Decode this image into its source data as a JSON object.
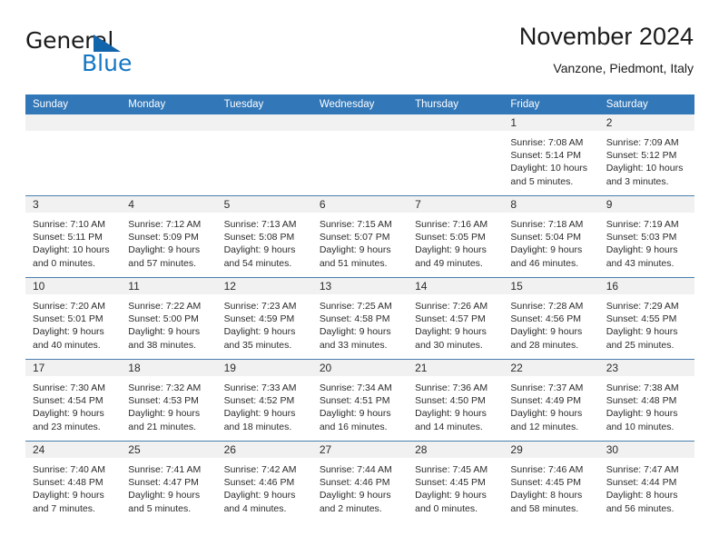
{
  "brand": {
    "name_part1": "General",
    "name_part2": "Blue",
    "triangle_color": "#1265ab",
    "blue_color": "#1477c4"
  },
  "header": {
    "title": "November 2024",
    "subtitle": "Vanzone, Piedmont, Italy"
  },
  "theme": {
    "header_blue": "#3277b8",
    "row_divider": "#4a7fae",
    "day_band": "#f1f1f1",
    "text": "#2b2b2b"
  },
  "calendar": {
    "weekday_headers": [
      "Sunday",
      "Monday",
      "Tuesday",
      "Wednesday",
      "Thursday",
      "Friday",
      "Saturday"
    ],
    "weeks": [
      [
        {
          "day": "",
          "sunrise": "",
          "sunset": "",
          "daylight": ""
        },
        {
          "day": "",
          "sunrise": "",
          "sunset": "",
          "daylight": ""
        },
        {
          "day": "",
          "sunrise": "",
          "sunset": "",
          "daylight": ""
        },
        {
          "day": "",
          "sunrise": "",
          "sunset": "",
          "daylight": ""
        },
        {
          "day": "",
          "sunrise": "",
          "sunset": "",
          "daylight": ""
        },
        {
          "day": "1",
          "sunrise": "Sunrise: 7:08 AM",
          "sunset": "Sunset: 5:14 PM",
          "daylight": "Daylight: 10 hours and 5 minutes."
        },
        {
          "day": "2",
          "sunrise": "Sunrise: 7:09 AM",
          "sunset": "Sunset: 5:12 PM",
          "daylight": "Daylight: 10 hours and 3 minutes."
        }
      ],
      [
        {
          "day": "3",
          "sunrise": "Sunrise: 7:10 AM",
          "sunset": "Sunset: 5:11 PM",
          "daylight": "Daylight: 10 hours and 0 minutes."
        },
        {
          "day": "4",
          "sunrise": "Sunrise: 7:12 AM",
          "sunset": "Sunset: 5:09 PM",
          "daylight": "Daylight: 9 hours and 57 minutes."
        },
        {
          "day": "5",
          "sunrise": "Sunrise: 7:13 AM",
          "sunset": "Sunset: 5:08 PM",
          "daylight": "Daylight: 9 hours and 54 minutes."
        },
        {
          "day": "6",
          "sunrise": "Sunrise: 7:15 AM",
          "sunset": "Sunset: 5:07 PM",
          "daylight": "Daylight: 9 hours and 51 minutes."
        },
        {
          "day": "7",
          "sunrise": "Sunrise: 7:16 AM",
          "sunset": "Sunset: 5:05 PM",
          "daylight": "Daylight: 9 hours and 49 minutes."
        },
        {
          "day": "8",
          "sunrise": "Sunrise: 7:18 AM",
          "sunset": "Sunset: 5:04 PM",
          "daylight": "Daylight: 9 hours and 46 minutes."
        },
        {
          "day": "9",
          "sunrise": "Sunrise: 7:19 AM",
          "sunset": "Sunset: 5:03 PM",
          "daylight": "Daylight: 9 hours and 43 minutes."
        }
      ],
      [
        {
          "day": "10",
          "sunrise": "Sunrise: 7:20 AM",
          "sunset": "Sunset: 5:01 PM",
          "daylight": "Daylight: 9 hours and 40 minutes."
        },
        {
          "day": "11",
          "sunrise": "Sunrise: 7:22 AM",
          "sunset": "Sunset: 5:00 PM",
          "daylight": "Daylight: 9 hours and 38 minutes."
        },
        {
          "day": "12",
          "sunrise": "Sunrise: 7:23 AM",
          "sunset": "Sunset: 4:59 PM",
          "daylight": "Daylight: 9 hours and 35 minutes."
        },
        {
          "day": "13",
          "sunrise": "Sunrise: 7:25 AM",
          "sunset": "Sunset: 4:58 PM",
          "daylight": "Daylight: 9 hours and 33 minutes."
        },
        {
          "day": "14",
          "sunrise": "Sunrise: 7:26 AM",
          "sunset": "Sunset: 4:57 PM",
          "daylight": "Daylight: 9 hours and 30 minutes."
        },
        {
          "day": "15",
          "sunrise": "Sunrise: 7:28 AM",
          "sunset": "Sunset: 4:56 PM",
          "daylight": "Daylight: 9 hours and 28 minutes."
        },
        {
          "day": "16",
          "sunrise": "Sunrise: 7:29 AM",
          "sunset": "Sunset: 4:55 PM",
          "daylight": "Daylight: 9 hours and 25 minutes."
        }
      ],
      [
        {
          "day": "17",
          "sunrise": "Sunrise: 7:30 AM",
          "sunset": "Sunset: 4:54 PM",
          "daylight": "Daylight: 9 hours and 23 minutes."
        },
        {
          "day": "18",
          "sunrise": "Sunrise: 7:32 AM",
          "sunset": "Sunset: 4:53 PM",
          "daylight": "Daylight: 9 hours and 21 minutes."
        },
        {
          "day": "19",
          "sunrise": "Sunrise: 7:33 AM",
          "sunset": "Sunset: 4:52 PM",
          "daylight": "Daylight: 9 hours and 18 minutes."
        },
        {
          "day": "20",
          "sunrise": "Sunrise: 7:34 AM",
          "sunset": "Sunset: 4:51 PM",
          "daylight": "Daylight: 9 hours and 16 minutes."
        },
        {
          "day": "21",
          "sunrise": "Sunrise: 7:36 AM",
          "sunset": "Sunset: 4:50 PM",
          "daylight": "Daylight: 9 hours and 14 minutes."
        },
        {
          "day": "22",
          "sunrise": "Sunrise: 7:37 AM",
          "sunset": "Sunset: 4:49 PM",
          "daylight": "Daylight: 9 hours and 12 minutes."
        },
        {
          "day": "23",
          "sunrise": "Sunrise: 7:38 AM",
          "sunset": "Sunset: 4:48 PM",
          "daylight": "Daylight: 9 hours and 10 minutes."
        }
      ],
      [
        {
          "day": "24",
          "sunrise": "Sunrise: 7:40 AM",
          "sunset": "Sunset: 4:48 PM",
          "daylight": "Daylight: 9 hours and 7 minutes."
        },
        {
          "day": "25",
          "sunrise": "Sunrise: 7:41 AM",
          "sunset": "Sunset: 4:47 PM",
          "daylight": "Daylight: 9 hours and 5 minutes."
        },
        {
          "day": "26",
          "sunrise": "Sunrise: 7:42 AM",
          "sunset": "Sunset: 4:46 PM",
          "daylight": "Daylight: 9 hours and 4 minutes."
        },
        {
          "day": "27",
          "sunrise": "Sunrise: 7:44 AM",
          "sunset": "Sunset: 4:46 PM",
          "daylight": "Daylight: 9 hours and 2 minutes."
        },
        {
          "day": "28",
          "sunrise": "Sunrise: 7:45 AM",
          "sunset": "Sunset: 4:45 PM",
          "daylight": "Daylight: 9 hours and 0 minutes."
        },
        {
          "day": "29",
          "sunrise": "Sunrise: 7:46 AM",
          "sunset": "Sunset: 4:45 PM",
          "daylight": "Daylight: 8 hours and 58 minutes."
        },
        {
          "day": "30",
          "sunrise": "Sunrise: 7:47 AM",
          "sunset": "Sunset: 4:44 PM",
          "daylight": "Daylight: 8 hours and 56 minutes."
        }
      ]
    ]
  }
}
